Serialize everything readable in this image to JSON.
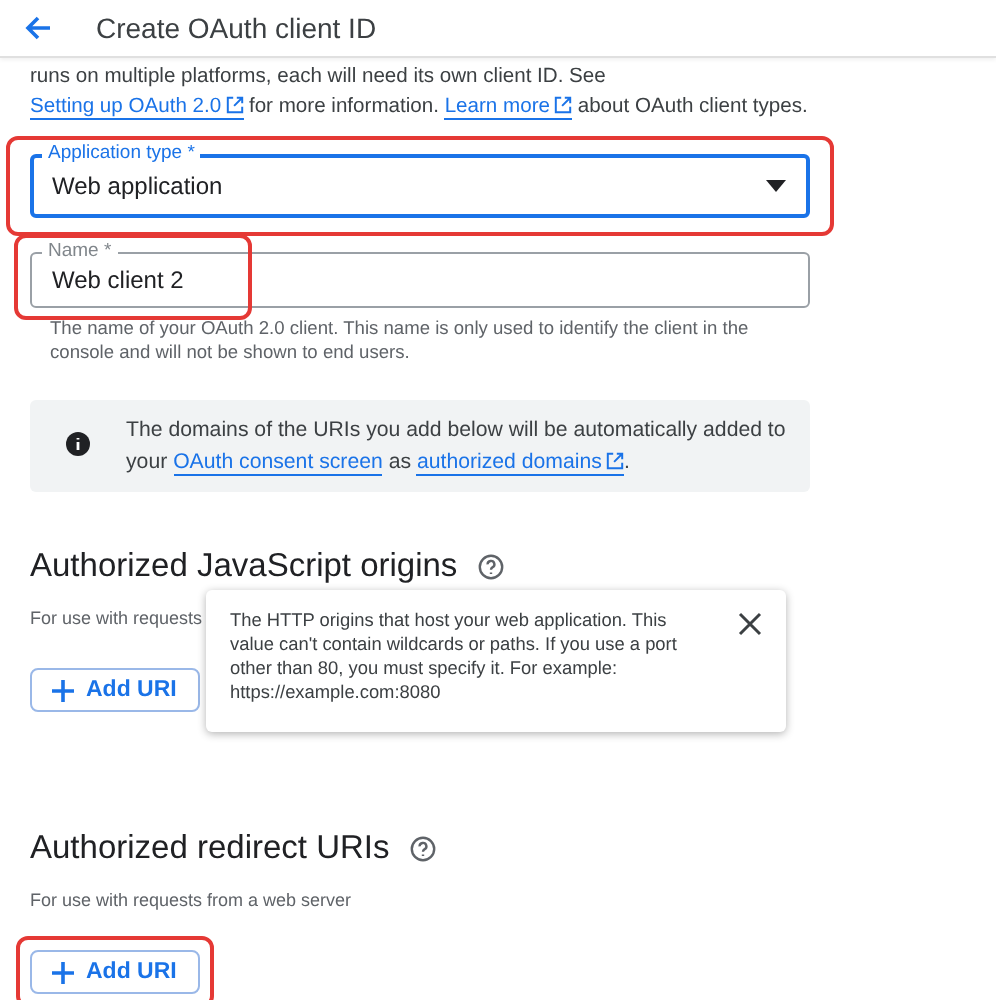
{
  "header": {
    "title": "Create OAuth client ID"
  },
  "intro": [
    {
      "kind": "text",
      "text": "runs on multiple platforms, each will need its own client ID. See "
    },
    {
      "kind": "link",
      "text": "Setting up OAuth 2.0",
      "external": true
    },
    {
      "kind": "text",
      "text": " for more information. "
    },
    {
      "kind": "link",
      "text": "Learn more",
      "external": true
    },
    {
      "kind": "text",
      "text": " about OAuth client types."
    }
  ],
  "application_type": {
    "label": "Application type *",
    "value": "Web application",
    "focused": true,
    "highlighted": true
  },
  "name_field": {
    "label": "Name *",
    "value": "Web client 2",
    "focused": false,
    "highlighted": true,
    "helper": "The name of your OAuth 2.0 client. This name is only used to identify the client in the console and will not be shown to end users."
  },
  "info_box": [
    {
      "kind": "text",
      "text": "The domains of the URIs you add below will be automatically added to your "
    },
    {
      "kind": "link",
      "text": "OAuth consent screen",
      "external": false
    },
    {
      "kind": "text",
      "text": " as "
    },
    {
      "kind": "link",
      "text": "authorized domains",
      "external": true
    },
    {
      "kind": "text",
      "text": "."
    }
  ],
  "sections": [
    {
      "title": "Authorized JavaScript origins",
      "description": "For use with requests",
      "button": "Add URI",
      "highlighted": false
    },
    {
      "title": "Authorized redirect URIs",
      "description": "For use with requests from a web server",
      "button": "Add URI",
      "highlighted": true
    }
  ],
  "tooltip": {
    "text": "The HTTP origins that host your web application. This value can't contain wildcards or paths. If you use a port other than 80, you must specify it. For example: https://example.com:8080"
  }
}
